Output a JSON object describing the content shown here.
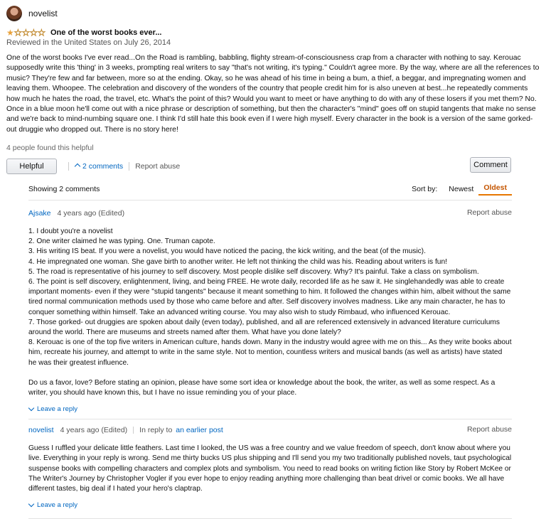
{
  "review": {
    "reviewer_name": "novelist",
    "rating": 1,
    "rating_max": 5,
    "title": "One of the worst books ever...",
    "date_line": "Reviewed in the United States on July 26, 2014",
    "body": "One of the worst books I've ever read...On the Road is rambling, babbling, flighty stream-of-consciousness crap from a character with nothing to say. Kerouac supposedly write this 'thing' in 3 weeks, prompting real writers to say \"that's not writing, it's typing.\" Couldn't agree more. By the way, where are all the references to music? They're few and far between, more so at the ending. Okay, so he was ahead of his time in being a bum, a thief, a beggar, and impregnating women and leaving them. Whoopee. The celebration and discovery of the wonders of the country that people credit him for is also uneven at best...he repeatedly comments how much he hates the road, the travel, etc. What's the point of this? Would you want to meet or have anything to do with any of these losers if you met them? No. Once in a blue moon he'll come out with a nice phrase or description of something, but then the character's \"mind\" goes off on stupid tangents that make no sense and we're back to mind-numbing square one. I think I'd still hate this book even if I were high myself. Every character in the book is a version of the same gorked-out druggie who dropped out. There is no story here!",
    "helpful_count": "4 people found this helpful",
    "helpful_label": "Helpful",
    "comments_toggle": "2 comments",
    "report_label": "Report abuse",
    "comment_label": "Comment"
  },
  "comments": {
    "showing": "Showing 2 comments",
    "sort_label": "Sort by:",
    "sort_newest": "Newest",
    "sort_oldest": "Oldest",
    "items": [
      {
        "author": "Ajsake",
        "meta": "4 years ago (Edited)",
        "report": "Report abuse",
        "lines": [
          "1. I doubt you're a novelist",
          "2. One writer claimed he was typing. One. Truman capote.",
          "3. His writing IS beat. If you were a novelist, you would have noticed the pacing, the kick writing, and the beat (of the music).",
          "4. He impregnated one woman. She gave birth to another writer. He left not thinking the child was his. Reading about writers is fun!",
          "5. The road is representative of his journey to self discovery. Most people dislike self discovery. Why? It's painful. Take a class on symbolism.",
          "6. The point is self discovery, enlightenment, living, and being FREE. He wrote daily, recorded life as he saw it. He singlehandedly was able to create important moments- even if they were \"stupid tangents\" because it meant something to him. It followed the changes within him, albeit without the same tired normal communication methods used by those who came before and after. Self discovery involves madness. Like any main character, he has to conquer something within himself. Take an advanced writing course. You may also wish to study Rimbaud, who influenced Kerouac.",
          "7. Those gorked- out druggies are spoken about daily (even today), published, and all are referenced extensively in advanced literature curriculums around the world. There are museums and streets named after them. What have you done lately?",
          "8. Kerouac is one of the top five writers in American culture, hands down. Many in the industry would agree with me on this... As they write books about him, recreate his journey, and attempt to write in the same style. Not to mention, countless writers and musical bands (as well as artists) have stated he was their greatest influence."
        ],
        "closing": "Do us a favor, love? Before stating an opinion, please have some sort idea or knowledge about the book, the writer, as well as some respect. As a writer, you should have known this, but I have no issue reminding you of your place.",
        "reply": "Leave a reply"
      },
      {
        "author": "novelist",
        "meta": "4 years ago (Edited)",
        "in_reply_to": "In reply to",
        "reply_link": "an earlier post",
        "report": "Report abuse",
        "body": "Guess I ruffled your delicate little feathers. Last time I looked, the US was a free country and we value freedom of speech, don't know about where you live. Everything in your reply is wrong. Send me thirty bucks US plus shipping and I'll send you my two traditionally published novels, taut psychological suspense books with compelling characters and complex plots and symbolism. You need to read books on writing fiction like Story by Robert McKee or The Writer's Journey by Christopher Vogler if you ever hope to enjoy reading anything more challenging than beat drivel or comic books. We all have different tastes, big deal if I hated your hero's claptrap.",
        "reply": "Leave a reply"
      }
    ]
  },
  "colors": {
    "link": "#0066c0",
    "star": "#e9a23b",
    "sort_active": "#c45500"
  },
  "icons": {
    "star": "star-icon",
    "chevron_up": "chevron-up-icon",
    "chevron_down": "chevron-down-icon"
  }
}
